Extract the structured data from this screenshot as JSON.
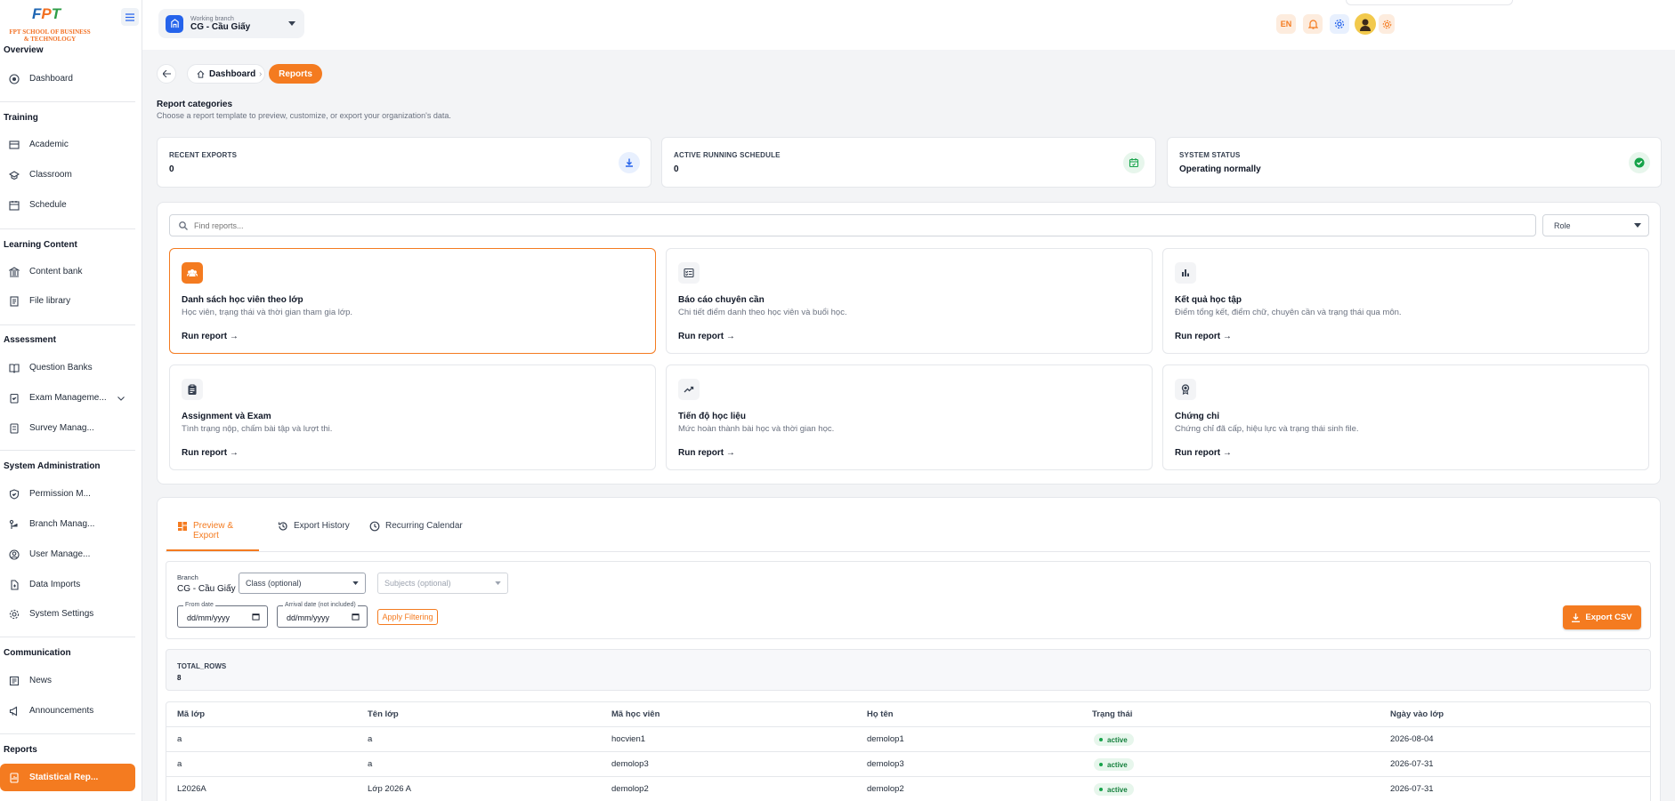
{
  "brand": {
    "logo_text": "FPT",
    "logo_sub_line1": "FPT SCHOOL OF BUSINESS",
    "logo_sub_line2": "& TECHNOLOGY"
  },
  "sidebar": {
    "groups": [
      {
        "label": "Overview",
        "items": [
          {
            "label": "Dashboard",
            "icon": "dashboard-icon"
          }
        ]
      },
      {
        "label": "Training",
        "items": [
          {
            "label": "Academic",
            "icon": "academic-icon"
          },
          {
            "label": "Classroom",
            "icon": "classroom-icon"
          },
          {
            "label": "Schedule",
            "icon": "calendar-icon"
          }
        ]
      },
      {
        "label": "Learning Content",
        "items": [
          {
            "label": "Content bank",
            "icon": "bank-icon"
          },
          {
            "label": "File library",
            "icon": "file-library-icon"
          }
        ]
      },
      {
        "label": "Assessment",
        "items": [
          {
            "label": "Question Banks",
            "icon": "book-open-icon"
          },
          {
            "label": "Exam Manageme...",
            "icon": "exam-icon"
          },
          {
            "label": "Survey Manag...",
            "icon": "survey-icon"
          }
        ]
      },
      {
        "label": "System Administration",
        "items": [
          {
            "label": "Permission M...",
            "icon": "shield-icon"
          },
          {
            "label": "Branch Manag...",
            "icon": "branch-icon"
          },
          {
            "label": "User Manage...",
            "icon": "user-icon"
          },
          {
            "label": "Data Imports",
            "icon": "import-icon"
          },
          {
            "label": "System Settings",
            "icon": "gear-icon"
          }
        ]
      },
      {
        "label": "Communication",
        "items": [
          {
            "label": "News",
            "icon": "news-icon"
          },
          {
            "label": "Announcements",
            "icon": "megaphone-icon"
          }
        ]
      },
      {
        "label": "Reports",
        "items": [
          {
            "label": "Statistical Rep...",
            "icon": "report-icon"
          }
        ]
      }
    ]
  },
  "topbar": {
    "branch_small": "Working branch",
    "branch_name": "CG - Cầu Giấy",
    "lang": "EN"
  },
  "breadcrumb": {
    "home": "Dashboard",
    "current": "Reports"
  },
  "section": {
    "title": "Report categories",
    "subtitle": "Choose a report template to preview, customize, or export your organization's data."
  },
  "stats": [
    {
      "label": "RECENT EXPORTS",
      "value": "0",
      "icon": "download-icon",
      "color": "#2563eb",
      "bg": "#e8f0fe"
    },
    {
      "label": "ACTIVE RUNNING SCHEDULE",
      "value": "0",
      "icon": "calendar-check-icon",
      "color": "#16a34a",
      "bg": "#e7f6ec"
    },
    {
      "label": "SYSTEM STATUS",
      "value": "Operating normally",
      "icon": "check-circle-icon",
      "color": "#16a34a",
      "bg": "#e7f6ec"
    }
  ],
  "search": {
    "placeholder": "Find reports..."
  },
  "role_filter": {
    "value": "Role"
  },
  "report_cards": [
    {
      "title": "Danh sách học viên theo lớp",
      "desc": "Học viên, trạng thái và thời gian tham gia lớp.",
      "run": "Run report →",
      "icon": "users-icon"
    },
    {
      "title": "Báo cáo chuyên cần",
      "desc": "Chi tiết điểm danh theo học viên và buổi học.",
      "run": "Run report →",
      "icon": "checklist-icon"
    },
    {
      "title": "Kết quả học tập",
      "desc": "Điểm tổng kết, điểm chữ, chuyên cần và trạng thái qua môn.",
      "run": "Run report →",
      "icon": "bar-chart-icon"
    },
    {
      "title": "Assignment và Exam",
      "desc": "Tình trạng nộp, chấm bài tập và lượt thi.",
      "run": "Run report →",
      "icon": "clipboard-icon"
    },
    {
      "title": "Tiến độ học liệu",
      "desc": "Mức hoàn thành bài học và thời gian học.",
      "run": "Run report →",
      "icon": "trend-icon"
    },
    {
      "title": "Chứng chỉ",
      "desc": "Chứng chỉ đã cấp, hiệu lực và trạng thái sinh file.",
      "run": "Run report →",
      "icon": "certificate-icon"
    }
  ],
  "tabs": [
    {
      "label": "Preview & Export",
      "icon": "grid-icon"
    },
    {
      "label": "Export History",
      "icon": "history-icon"
    },
    {
      "label": "Recurring Calendar",
      "icon": "clock-icon"
    }
  ],
  "filters": {
    "branch_label": "Branch",
    "branch_value": "CG - Cầu Giấy",
    "class_placeholder": "Class (optional)",
    "subjects_placeholder": "Subjects (optional)",
    "from_label": "From date",
    "from_value": "dd/mm/yyyy",
    "arrival_label": "Arrival date (not included)",
    "arrival_value": "dd/mm/yyyy",
    "apply_label": "Apply Filtering",
    "export_label": "Export CSV"
  },
  "total": {
    "key": "TOTAL_ROWS",
    "value": "8"
  },
  "table": {
    "headers": [
      "Mã lớp",
      "Tên lớp",
      "Mã học viên",
      "Họ tên",
      "Trạng thái",
      "Ngày vào lớp"
    ],
    "rows": [
      [
        "a",
        "a",
        "hocvien1",
        "demolop1",
        "active",
        "2026-08-04"
      ],
      [
        "a",
        "a",
        "demolop3",
        "demolop3",
        "active",
        "2026-07-31"
      ],
      [
        "L2026A",
        "Lớp 2026 A",
        "demolop2",
        "demolop2",
        "active",
        "2026-07-31"
      ]
    ]
  }
}
